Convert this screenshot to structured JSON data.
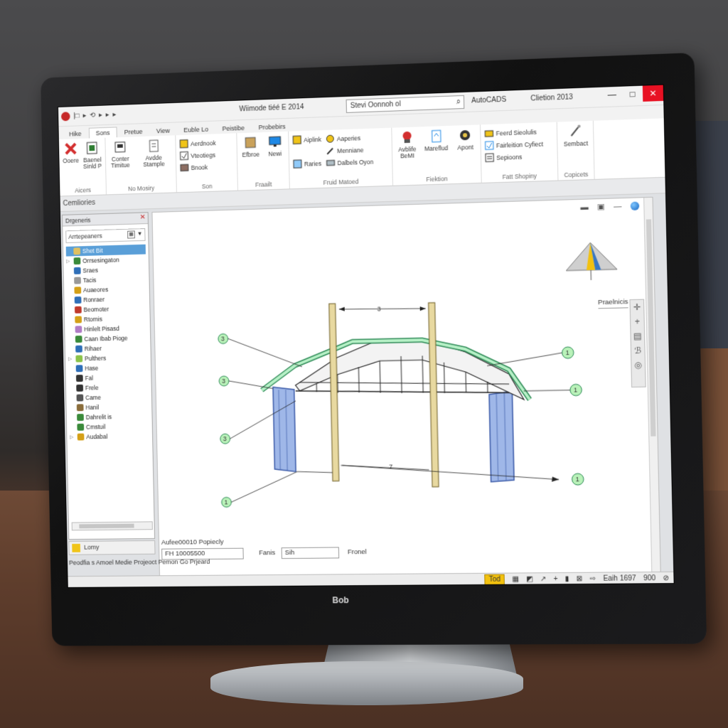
{
  "window": {
    "doc_title": "Wiimode tiéé E 2014",
    "search_placeholder": "Stevi Oonnoh ol",
    "app_name": "AutoCADS",
    "app_version": "Clietion 2013",
    "minimize": "—",
    "maximize": "□",
    "close": "✕"
  },
  "qat": [
    "⏺",
    "|□",
    "▸",
    "⟲",
    "▸",
    "▸",
    "▸"
  ],
  "tabs": [
    "Hike",
    "Sons",
    "Pretue",
    "View",
    "Euble Lo",
    "Peistibe",
    "Probebirs"
  ],
  "active_tab": "Sons",
  "ribbon": {
    "groups": [
      {
        "name": "Aicers",
        "buttons": [
          "Ooere",
          "Baenel Sinld P"
        ]
      },
      {
        "name": "No Mosiry",
        "buttons": [
          "Conter Timitue",
          "Avdde Stample"
        ]
      },
      {
        "name": "Son",
        "small": [
          "Aerdnook",
          "Vteotiegs",
          "Bnook"
        ]
      },
      {
        "name": "Fraailt",
        "buttons": [
          "Efbroe",
          "Newi"
        ]
      },
      {
        "name": "Fruid Matoed",
        "small": [
          "Aiplink",
          "Raries"
        ],
        "small2": [
          "Aaperies",
          "Menniane",
          "Dalbels Oyon"
        ]
      },
      {
        "name": "Fiektion",
        "buttons": [
          "Avblife BeMI",
          "Mareflud",
          "Apont"
        ]
      },
      {
        "name": "Fatt Shopiny",
        "small": [
          "Feerd Sieolulis",
          "Fairleition Cyfiect",
          "Sepioons"
        ]
      },
      {
        "name": "Copicets",
        "buttons": [
          "Sembact"
        ]
      }
    ]
  },
  "panel_label": "Cemliories",
  "palette": {
    "title": "Drgeneris",
    "dropdown": "Arrtepeaners",
    "items": [
      {
        "label": "Shet Bit",
        "color": "#e0c060",
        "expand": ""
      },
      {
        "label": "Orrsesingaton",
        "color": "#3a8a3a",
        "expand": "▷"
      },
      {
        "label": "Sraes",
        "color": "#2f6fb8",
        "expand": ""
      },
      {
        "label": "Tacis",
        "color": "#999999",
        "expand": ""
      },
      {
        "label": "Auaeores",
        "color": "#d4a017",
        "expand": ""
      },
      {
        "label": "Ronraer",
        "color": "#2f6fb8",
        "expand": ""
      },
      {
        "label": "Beomoter",
        "color": "#c0392b",
        "expand": ""
      },
      {
        "label": "Rtornis",
        "color": "#d4a017",
        "expand": ""
      },
      {
        "label": "Hinlelt Pisasd",
        "color": "#b07cc6",
        "expand": ""
      },
      {
        "label": "Caan Ibab Pioge",
        "color": "#3a8a3a",
        "expand": ""
      },
      {
        "label": "Rihaer",
        "color": "#2f6fb8",
        "expand": ""
      },
      {
        "label": "Pulthers",
        "color": "#8bc34a",
        "expand": "▷"
      },
      {
        "label": "Hase",
        "color": "#2f6fb8",
        "expand": ""
      },
      {
        "label": "Fal",
        "color": "#333333",
        "expand": ""
      },
      {
        "label": "Frele",
        "color": "#333333",
        "expand": ""
      },
      {
        "label": "Came",
        "color": "#555555",
        "expand": ""
      },
      {
        "label": "Hanil",
        "color": "#8a6d3b",
        "expand": ""
      },
      {
        "label": "Dahrelit is",
        "color": "#3a8a3a",
        "expand": ""
      },
      {
        "label": "Cmstuil",
        "color": "#3a8a3a",
        "expand": ""
      },
      {
        "label": "Audabal",
        "color": "#d4a017",
        "expand": "▷"
      }
    ],
    "footer_label": "Lomy"
  },
  "canvas": {
    "viewcube_label": "Praelnicis",
    "callouts_left": [
      "3",
      "3",
      "3",
      "1"
    ],
    "callouts_right": [
      "1",
      "1",
      "1"
    ],
    "dim_top": "3",
    "dim_bottom": "7"
  },
  "properties": {
    "title": "Aufee00010 Popiecly",
    "field1": "FH 10005500",
    "label2": "Fanis",
    "field2": "Sih",
    "button": "Fronel"
  },
  "bottom_left": "Peodfia s Amoel Medie Projeoct   Pemon Go Prjeard",
  "statusbar": {
    "active": "Tod",
    "coords": "Eaih 1697",
    "zoom": "900"
  },
  "monitor_brand": "Bob"
}
